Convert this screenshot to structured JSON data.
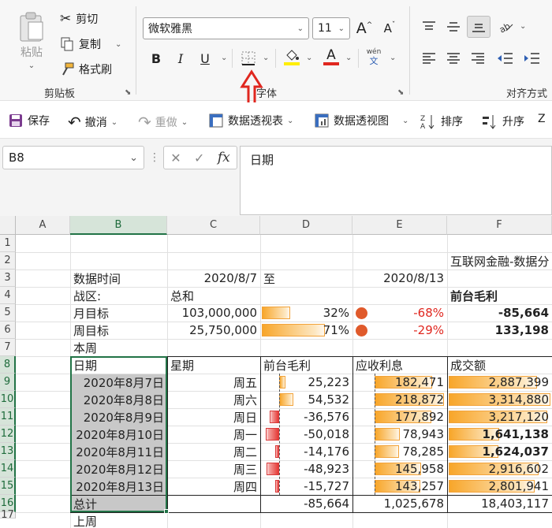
{
  "ribbon": {
    "clipboard": {
      "paste_label": "粘贴",
      "cut_label": "剪切",
      "copy_label": "复制",
      "format_painter_label": "格式刷",
      "group_label": "剪贴板"
    },
    "font": {
      "font_name": "微软雅黑",
      "font_size": "11",
      "group_label": "字体",
      "bold": "B",
      "italic": "I",
      "underline": "U",
      "grow": "A",
      "shrink": "A",
      "font_color_letter": "A",
      "phonetic_top": "wén",
      "phonetic_bottom": "文"
    },
    "alignment": {
      "group_label": "对齐方式"
    }
  },
  "qat": {
    "save_label": "保存",
    "undo_label": "撤消",
    "redo_label": "重做",
    "pivot_table_label": "数据透视表",
    "pivot_chart_label": "数据透视图",
    "sort_desc_label": "排序",
    "sort_asc_label": "升序",
    "sort_prefix": "Z",
    "sort_prefix2": "A"
  },
  "formula_bar": {
    "name_box": "B8",
    "fx": "fx",
    "content": "日期"
  },
  "colors": {
    "accent": "#217346",
    "annotation_arrow": "#e0271f",
    "databar_orange": "#f8a62a",
    "databar_red": "#e53935",
    "negative_text": "#e0271f",
    "status_dot": "#e05a2b"
  },
  "grid": {
    "columns": [
      "A",
      "B",
      "C",
      "D",
      "E",
      "F"
    ],
    "rows": [
      "1",
      "2",
      "3",
      "4",
      "5",
      "6",
      "7",
      "8",
      "9",
      "10",
      "11",
      "12",
      "13",
      "14",
      "15",
      "16",
      "17"
    ],
    "F2": "互联网金融-数据分",
    "B3": "数据时间",
    "C3": "2020/8/7",
    "D3": "至",
    "E3": "2020/8/13",
    "B4": "战区:",
    "C4": "总和",
    "F4": "前台毛利",
    "B5": "月目标",
    "C5": "103,000,000",
    "D5": "32%",
    "E5": "-68%",
    "F5": "-85,664",
    "B6": "周目标",
    "C6": "25,750,000",
    "D6": "71%",
    "E6": "-29%",
    "F6": "133,198",
    "B7": "本周",
    "headers": [
      "日期",
      "星期",
      "前台毛利",
      "应收利息",
      "成交额"
    ],
    "table_rows": [
      {
        "date": "2020年8月7日",
        "weekday": "周五",
        "gross": "25,223",
        "interest": "182,471",
        "volume": "2,887,399"
      },
      {
        "date": "2020年8月8日",
        "weekday": "周六",
        "gross": "54,532",
        "interest": "218,872",
        "volume": "3,314,880"
      },
      {
        "date": "2020年8月9日",
        "weekday": "周日",
        "gross": "-36,576",
        "interest": "177,892",
        "volume": "3,217,120"
      },
      {
        "date": "2020年8月10日",
        "weekday": "周一",
        "gross": "-50,018",
        "interest": "78,943",
        "volume": "1,641,138"
      },
      {
        "date": "2020年8月11日",
        "weekday": "周二",
        "gross": "-14,176",
        "interest": "78,285",
        "volume": "1,624,037"
      },
      {
        "date": "2020年8月12日",
        "weekday": "周三",
        "gross": "-48,923",
        "interest": "145,958",
        "volume": "2,916,602"
      },
      {
        "date": "2020年8月13日",
        "weekday": "周四",
        "gross": "-15,727",
        "interest": "143,257",
        "volume": "2,801,941"
      }
    ],
    "total_label": "总计",
    "total_gross": "-85,664",
    "total_interest": "1,025,678",
    "total_volume": "18,403,117",
    "B17": "上周",
    "progress": {
      "month_pct": 0.32,
      "week_pct": 0.71
    }
  }
}
